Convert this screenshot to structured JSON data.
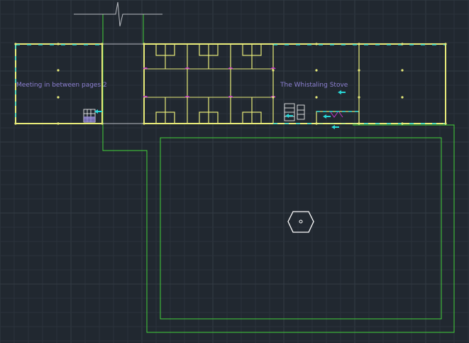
{
  "drawing": {
    "rooms": [
      {
        "label": "Meeting in between pages 2"
      },
      {
        "label": "The Whistaling Stove"
      }
    ],
    "colors": {
      "background": "#212830",
      "grid_minor": "#2a323b",
      "grid_major": "#323b45",
      "walls": "#e9ec7a",
      "outline": "#43d23a",
      "gray_lines": "#b9bcc2",
      "accent_cyan": "#28d7d7",
      "accent_magenta": "#c235c9",
      "label_purple": "#8c7fd1",
      "symbol_white": "#ffffff"
    },
    "icons": [
      "break-line-icon",
      "furniture-block-icon",
      "arrow-icon",
      "hexagon-marker-icon"
    ]
  }
}
